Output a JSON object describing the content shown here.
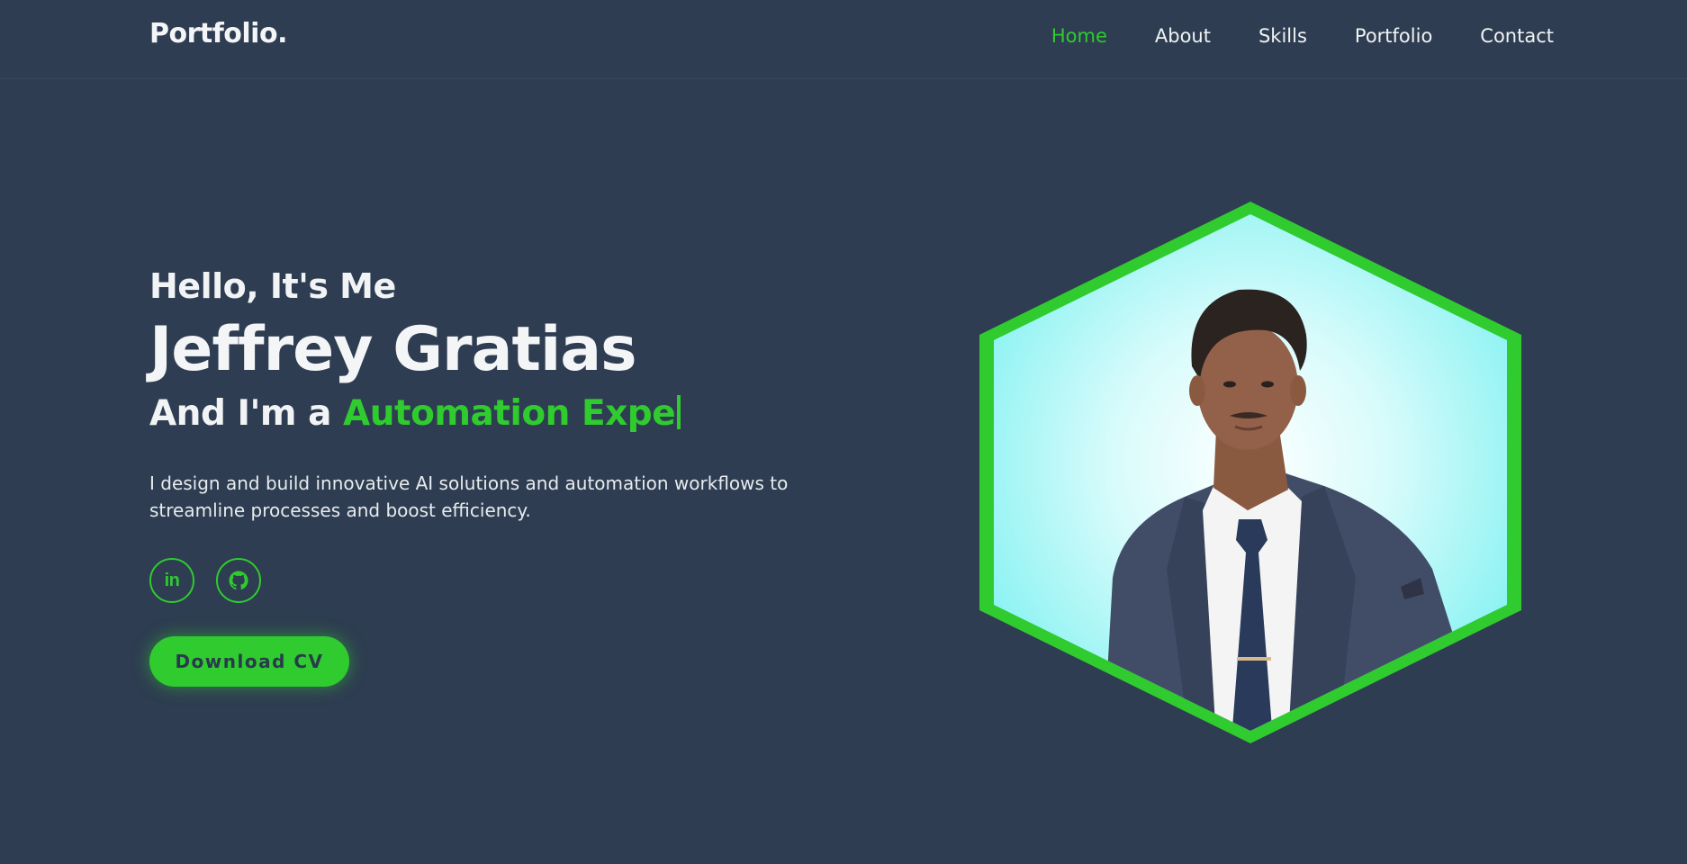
{
  "nav": {
    "logo": "Portfolio.",
    "links": [
      {
        "label": "Home",
        "active": true
      },
      {
        "label": "About",
        "active": false
      },
      {
        "label": "Skills",
        "active": false
      },
      {
        "label": "Portfolio",
        "active": false
      },
      {
        "label": "Contact",
        "active": false
      }
    ]
  },
  "hero": {
    "greeting": "Hello, It's Me",
    "name": "Jeffrey Gratias",
    "role_prefix": "And I'm a",
    "role_typed": "Automation Expe",
    "description": "I design and build innovative AI solutions and automation workflows to streamline processes and boost efficiency.",
    "socials": [
      {
        "icon": "linkedin-icon",
        "label": "in"
      },
      {
        "icon": "github-icon"
      }
    ],
    "cta_label": "Download CV"
  },
  "colors": {
    "background": "#2e3d51",
    "accent": "#2fcb2f",
    "text": "#f1f3f5"
  }
}
